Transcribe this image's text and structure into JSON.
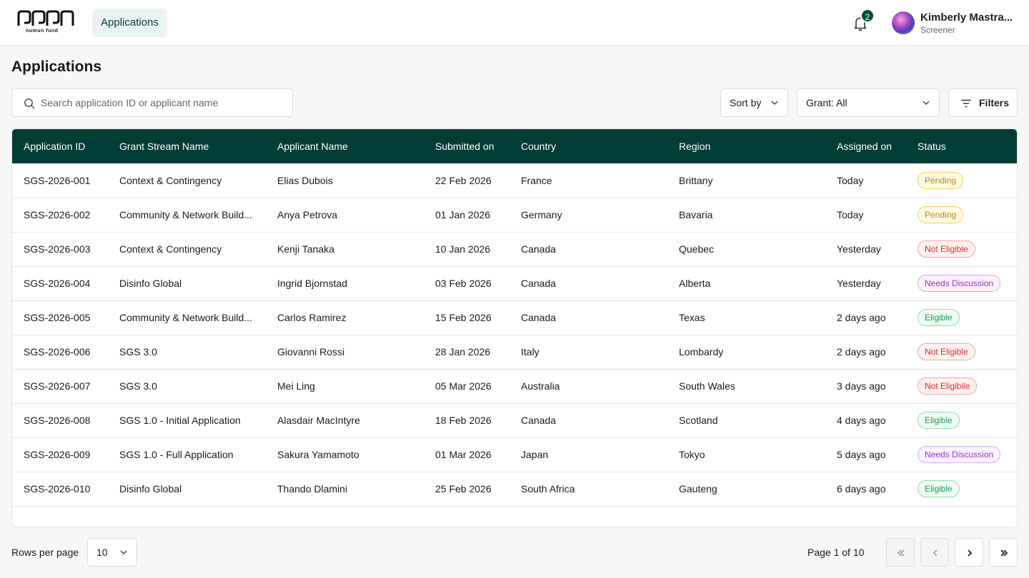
{
  "brand": {
    "logo_text": "numun fund"
  },
  "nav": {
    "tab_label": "Applications"
  },
  "notifications": {
    "count": "2"
  },
  "user": {
    "name": "Kimberly Mastra...",
    "role": "Screener"
  },
  "page": {
    "title": "Applications"
  },
  "search": {
    "placeholder": "Search application ID or applicant name",
    "value": ""
  },
  "controls": {
    "sort_label": "Sort by",
    "grant_label": "Grant: All",
    "filters_label": "Filters"
  },
  "table": {
    "columns": [
      "Application ID",
      "Grant Stream Name",
      "Applicant Name",
      "Submitted on",
      "Country",
      "Region",
      "Assigned on",
      "Status"
    ],
    "rows": [
      {
        "id": "SGS-2026-001",
        "grant": "Context & Contingency",
        "applicant": "Elias Dubois",
        "submitted": "22 Feb 2026",
        "country": "France",
        "region": "Brittany",
        "assigned": "Today",
        "status": "Pending"
      },
      {
        "id": "SGS-2026-002",
        "grant": "Community & Network Build...",
        "applicant": "Anya Petrova",
        "submitted": "01 Jan 2026",
        "country": "Germany",
        "region": "Bavaria",
        "assigned": "Today",
        "status": "Pending"
      },
      {
        "id": "SGS-2026-003",
        "grant": "Context & Contingency",
        "applicant": "Kenji Tanaka",
        "submitted": "10 Jan 2026",
        "country": "Canada",
        "region": "Quebec",
        "assigned": "Yesterday",
        "status": "Not Eligible"
      },
      {
        "id": "SGS-2026-004",
        "grant": "Disinfo Global",
        "applicant": "Ingrid Bjornstad",
        "submitted": "03 Feb 2026",
        "country": "Canada",
        "region": "Alberta",
        "assigned": "Yesterday",
        "status": "Needs Discussion"
      },
      {
        "id": "SGS-2026-005",
        "grant": "Community & Network Build...",
        "applicant": "Carlos Ramirez",
        "submitted": "15 Feb 2026",
        "country": "Canada",
        "region": "Texas",
        "assigned": "2 days ago",
        "status": "Eligible"
      },
      {
        "id": "SGS-2026-006",
        "grant": "SGS 3.0",
        "applicant": "Giovanni Rossi",
        "submitted": "28 Jan 2026",
        "country": "Italy",
        "region": "Lombardy",
        "assigned": "2 days ago",
        "status": "Not Eligible"
      },
      {
        "id": "SGS-2026-007",
        "grant": "SGS 3.0",
        "applicant": "Mei Ling",
        "submitted": "05 Mar 2026",
        "country": "Australia",
        "region": "South Wales",
        "assigned": "3 days ago",
        "status": "Not Eligibile"
      },
      {
        "id": "SGS-2026-008",
        "grant": "SGS 1.0 - Initial Application",
        "applicant": "Alasdair MacIntyre",
        "submitted": "18 Feb 2026",
        "country": "Canada",
        "region": "Scotland",
        "assigned": "4 days ago",
        "status": "Eligible"
      },
      {
        "id": "SGS-2026-009",
        "grant": "SGS 1.0 - Full Application",
        "applicant": "Sakura Yamamoto",
        "submitted": "01 Mar 2026",
        "country": "Japan",
        "region": "Tokyo",
        "assigned": "5 days ago",
        "status": "Needs Discussion"
      },
      {
        "id": "SGS-2026-010",
        "grant": "Disinfo Global",
        "applicant": "Thando Dlamini",
        "submitted": "25 Feb 2026",
        "country": "South Africa",
        "region": "Gauteng",
        "assigned": "6 days ago",
        "status": "Eligible"
      }
    ]
  },
  "status_colors": {
    "Pending": "#b7860b",
    "Not Eligible": "#d62e2e",
    "Needs Discussion": "#9b35cf",
    "Eligible": "#1f9a4e"
  },
  "pagination": {
    "rows_per_page_label": "Rows per page",
    "rows_per_page_value": "10",
    "page_info": "Page 1 of 10"
  },
  "colors": {
    "header_bg": "#003d36",
    "accent": "#004d40"
  }
}
